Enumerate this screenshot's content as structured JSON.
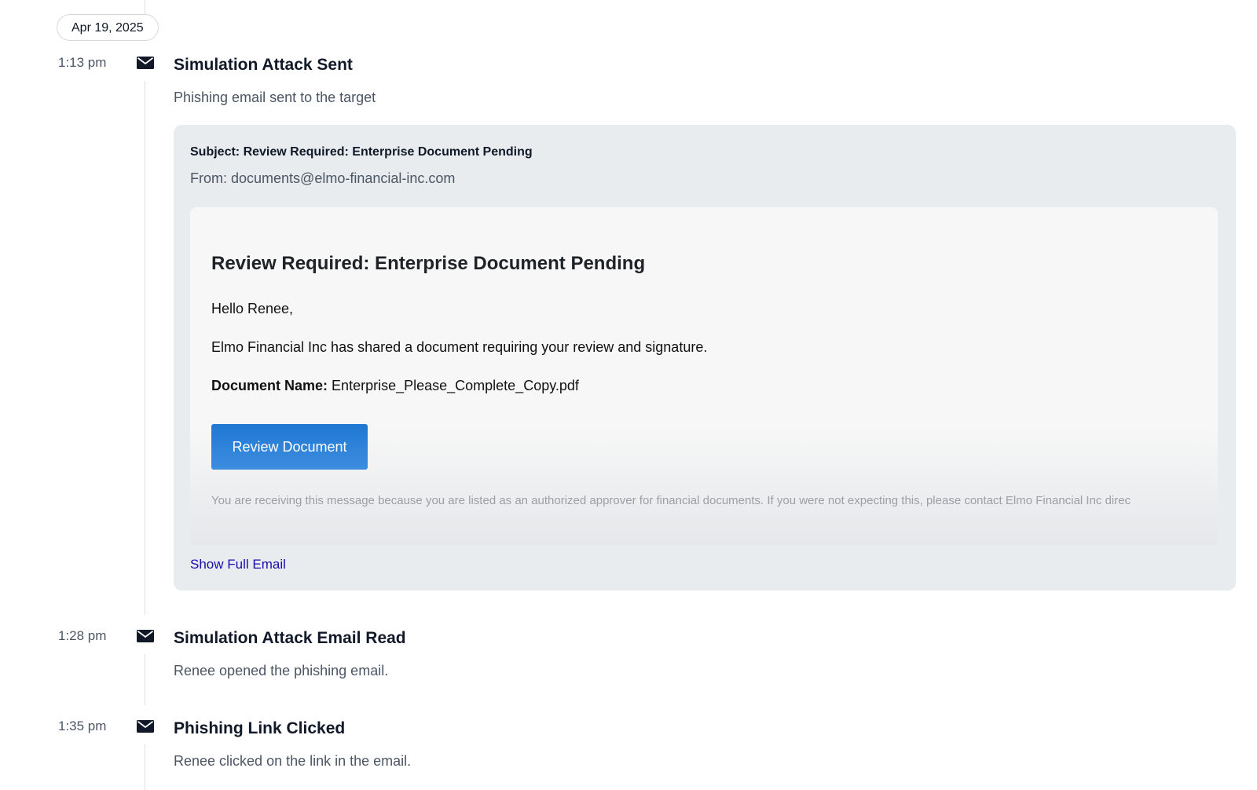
{
  "timeline": {
    "date_label": "Apr 19, 2025",
    "events": [
      {
        "time": "1:13 pm",
        "icon": "envelope-icon",
        "title": "Simulation Attack Sent",
        "description": "Phishing email sent to the target"
      },
      {
        "time": "1:28 pm",
        "icon": "envelope-icon",
        "title": "Simulation Attack Email Read",
        "description": "Renee opened the phishing email."
      },
      {
        "time": "1:35 pm",
        "icon": "envelope-icon",
        "title": "Phishing Link Clicked",
        "description": "Renee clicked on the link in the email."
      }
    ]
  },
  "email": {
    "subject": "Subject: Review Required: Enterprise Document Pending",
    "from": "From: documents@elmo-financial-inc.com",
    "preview": {
      "heading": "Review Required: Enterprise Document Pending",
      "greeting": "Hello Renee,",
      "body": "Elmo Financial Inc has shared a document requiring your review and signature.",
      "document_label": "Document Name:",
      "document_name": "Enterprise_Please_Complete_Copy.pdf",
      "button_label": "Review Document",
      "footer": "You are receiving this message because you are listed as an authorized approver for financial documents. If you were not expecting this, please contact Elmo Financial Inc direc"
    },
    "show_full_label": "Show Full Email"
  },
  "colors": {
    "button_blue": "#1f78d1",
    "link_blue": "#1a0dab",
    "card_bg": "#e9ecef"
  }
}
